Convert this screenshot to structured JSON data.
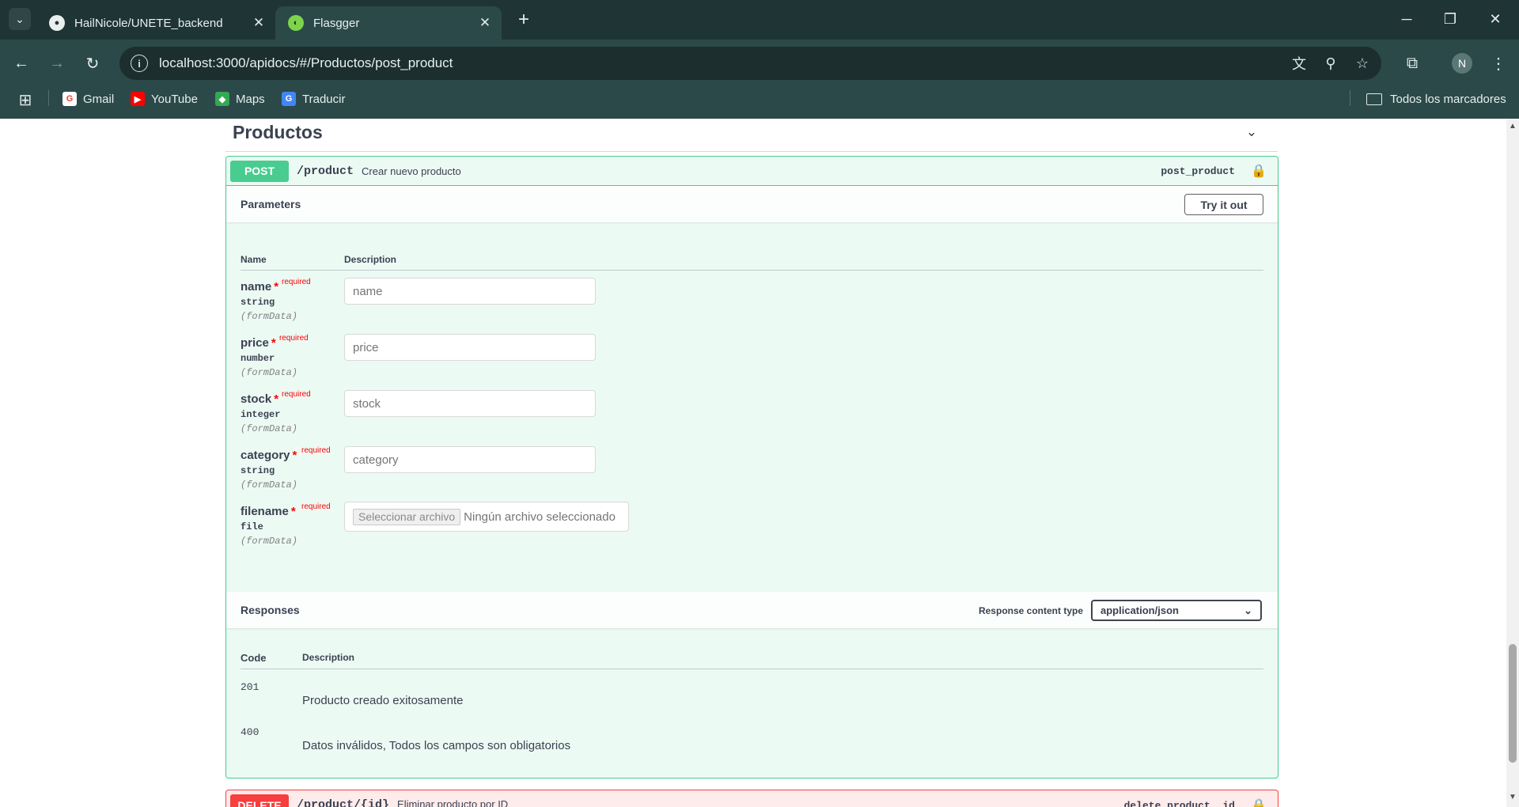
{
  "browser": {
    "tabs": [
      {
        "title": "HailNicole/UNETE_backend",
        "favicon": "github-icon",
        "active": false
      },
      {
        "title": "Flasgger",
        "favicon": "flasgger-icon",
        "active": true
      }
    ],
    "url": "localhost:3000/apidocs/#/Productos/post_product",
    "profile_initial": "N",
    "bookmarks": [
      {
        "label": "Gmail",
        "icon": "gmail-icon"
      },
      {
        "label": "YouTube",
        "icon": "youtube-icon"
      },
      {
        "label": "Maps",
        "icon": "maps-icon"
      },
      {
        "label": "Traducir",
        "icon": "translate-icon"
      }
    ],
    "all_bookmarks_label": "Todos los marcadores"
  },
  "page": {
    "section_title": "Productos",
    "operation": {
      "method": "POST",
      "path": "/product",
      "summary": "Crear nuevo producto",
      "operation_id": "post_product",
      "parameters_title": "Parameters",
      "try_it_out_label": "Try it out",
      "table_headers": {
        "name": "Name",
        "description": "Description"
      },
      "required_label": "required",
      "parameters": [
        {
          "name": "name",
          "type": "string",
          "in": "(formData)",
          "placeholder": "name"
        },
        {
          "name": "price",
          "type": "number",
          "in": "(formData)",
          "placeholder": "price"
        },
        {
          "name": "stock",
          "type": "integer",
          "in": "(formData)",
          "placeholder": "stock"
        },
        {
          "name": "category",
          "type": "string",
          "in": "(formData)",
          "placeholder": "category"
        },
        {
          "name": "filename",
          "type": "file",
          "in": "(formData)",
          "file_button": "Seleccionar archivo",
          "file_status": "Ningún archivo seleccionado"
        }
      ],
      "responses_title": "Responses",
      "response_content_type_label": "Response content type",
      "response_content_type": "application/json",
      "response_headers": {
        "code": "Code",
        "description": "Description"
      },
      "responses": [
        {
          "code": "201",
          "description": "Producto creado exitosamente"
        },
        {
          "code": "400",
          "description": "Datos inválidos, Todos los campos son obligatorios"
        }
      ]
    },
    "next_operation": {
      "method": "DELETE",
      "path": "/product/{id}",
      "summary": "Eliminar producto por ID",
      "operation_id": "delete_product__id"
    }
  },
  "colors": {
    "post": "#49cc90",
    "delete": "#f93e3e",
    "browser_frame": "#1f3434",
    "browser_toolbar": "#2c4949"
  }
}
